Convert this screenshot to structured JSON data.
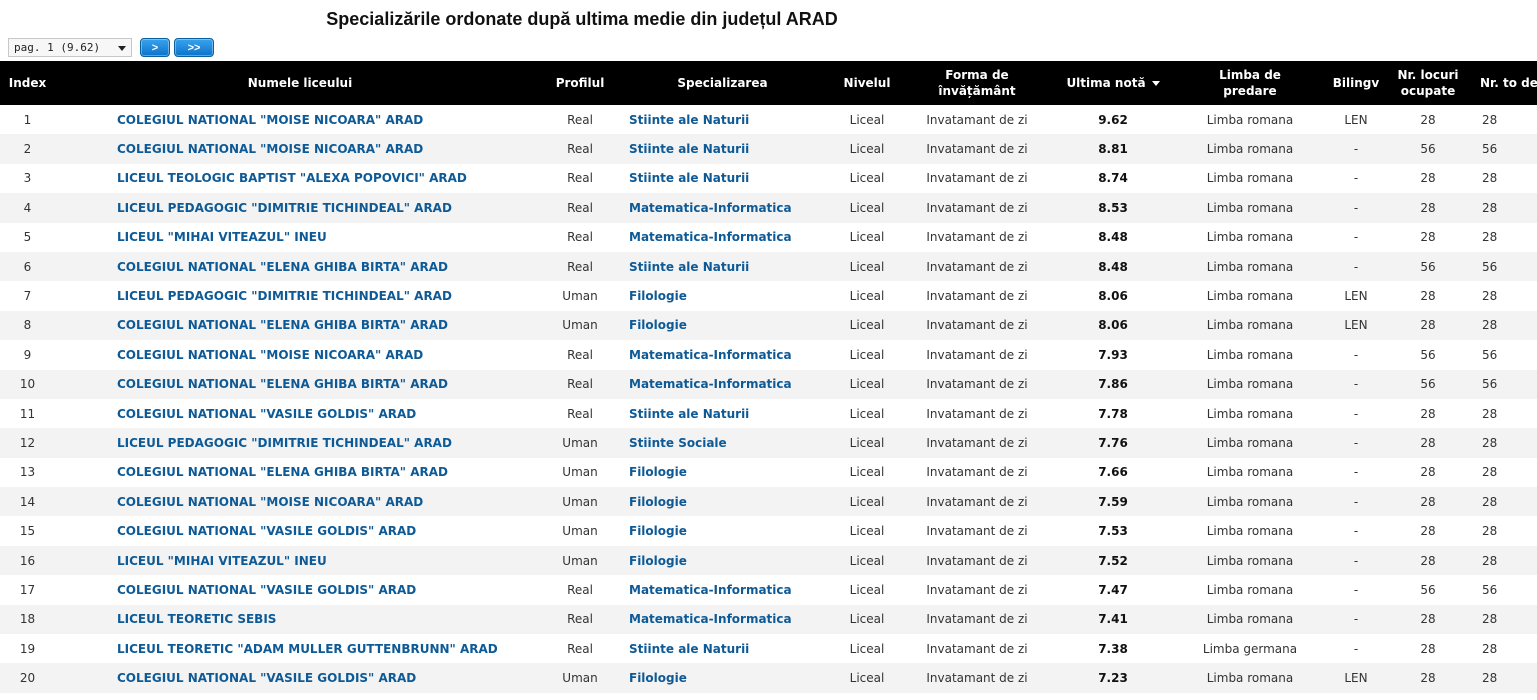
{
  "page": {
    "title": "Specializările ordonate după ultima medie din județul ARAD"
  },
  "pager": {
    "selected": "pag. 1 (9.62)",
    "next_label": ">",
    "last_label": ">>"
  },
  "table": {
    "headers": {
      "index": "Index",
      "school": "Numele liceului",
      "profile": "Profilul",
      "specialization": "Specializarea",
      "level": "Nivelul",
      "form": "Forma de învățământ",
      "last_grade": "Ultima notă",
      "language": "Limba de predare",
      "bilingual": "Bilingv",
      "occupied": "Nr. locuri ocupate",
      "total": "Nr. to de loc"
    },
    "rows": [
      {
        "index": "1",
        "school": "COLEGIUL NATIONAL \"MOISE NICOARA\" ARAD",
        "profile": "Real",
        "spec": "Stiinte ale Naturii",
        "level": "Liceal",
        "form": "Invatamant de zi",
        "grade": "9.62",
        "lang": "Limba romana",
        "bilingv": "LEN",
        "occupied": "28",
        "total": "28"
      },
      {
        "index": "2",
        "school": "COLEGIUL NATIONAL \"MOISE NICOARA\" ARAD",
        "profile": "Real",
        "spec": "Stiinte ale Naturii",
        "level": "Liceal",
        "form": "Invatamant de zi",
        "grade": "8.81",
        "lang": "Limba romana",
        "bilingv": "-",
        "occupied": "56",
        "total": "56"
      },
      {
        "index": "3",
        "school": "LICEUL TEOLOGIC BAPTIST \"ALEXA POPOVICI\" ARAD",
        "profile": "Real",
        "spec": "Stiinte ale Naturii",
        "level": "Liceal",
        "form": "Invatamant de zi",
        "grade": "8.74",
        "lang": "Limba romana",
        "bilingv": "-",
        "occupied": "28",
        "total": "28"
      },
      {
        "index": "4",
        "school": "LICEUL PEDAGOGIC \"DIMITRIE TICHINDEAL\" ARAD",
        "profile": "Real",
        "spec": "Matematica-Informatica",
        "level": "Liceal",
        "form": "Invatamant de zi",
        "grade": "8.53",
        "lang": "Limba romana",
        "bilingv": "-",
        "occupied": "28",
        "total": "28"
      },
      {
        "index": "5",
        "school": "LICEUL \"MIHAI VITEAZUL\" INEU",
        "profile": "Real",
        "spec": "Matematica-Informatica",
        "level": "Liceal",
        "form": "Invatamant de zi",
        "grade": "8.48",
        "lang": "Limba romana",
        "bilingv": "-",
        "occupied": "28",
        "total": "28"
      },
      {
        "index": "6",
        "school": "COLEGIUL NATIONAL \"ELENA GHIBA BIRTA\" ARAD",
        "profile": "Real",
        "spec": "Stiinte ale Naturii",
        "level": "Liceal",
        "form": "Invatamant de zi",
        "grade": "8.48",
        "lang": "Limba romana",
        "bilingv": "-",
        "occupied": "56",
        "total": "56"
      },
      {
        "index": "7",
        "school": "LICEUL PEDAGOGIC \"DIMITRIE TICHINDEAL\" ARAD",
        "profile": "Uman",
        "spec": "Filologie",
        "level": "Liceal",
        "form": "Invatamant de zi",
        "grade": "8.06",
        "lang": "Limba romana",
        "bilingv": "LEN",
        "occupied": "28",
        "total": "28"
      },
      {
        "index": "8",
        "school": "COLEGIUL NATIONAL \"ELENA GHIBA BIRTA\" ARAD",
        "profile": "Uman",
        "spec": "Filologie",
        "level": "Liceal",
        "form": "Invatamant de zi",
        "grade": "8.06",
        "lang": "Limba romana",
        "bilingv": "LEN",
        "occupied": "28",
        "total": "28"
      },
      {
        "index": "9",
        "school": "COLEGIUL NATIONAL \"MOISE NICOARA\" ARAD",
        "profile": "Real",
        "spec": "Matematica-Informatica",
        "level": "Liceal",
        "form": "Invatamant de zi",
        "grade": "7.93",
        "lang": "Limba romana",
        "bilingv": "-",
        "occupied": "56",
        "total": "56"
      },
      {
        "index": "10",
        "school": "COLEGIUL NATIONAL \"ELENA GHIBA BIRTA\" ARAD",
        "profile": "Real",
        "spec": "Matematica-Informatica",
        "level": "Liceal",
        "form": "Invatamant de zi",
        "grade": "7.86",
        "lang": "Limba romana",
        "bilingv": "-",
        "occupied": "56",
        "total": "56"
      },
      {
        "index": "11",
        "school": "COLEGIUL NATIONAL \"VASILE GOLDIS\" ARAD",
        "profile": "Real",
        "spec": "Stiinte ale Naturii",
        "level": "Liceal",
        "form": "Invatamant de zi",
        "grade": "7.78",
        "lang": "Limba romana",
        "bilingv": "-",
        "occupied": "28",
        "total": "28"
      },
      {
        "index": "12",
        "school": "LICEUL PEDAGOGIC \"DIMITRIE TICHINDEAL\" ARAD",
        "profile": "Uman",
        "spec": "Stiinte Sociale",
        "level": "Liceal",
        "form": "Invatamant de zi",
        "grade": "7.76",
        "lang": "Limba romana",
        "bilingv": "-",
        "occupied": "28",
        "total": "28"
      },
      {
        "index": "13",
        "school": "COLEGIUL NATIONAL \"ELENA GHIBA BIRTA\" ARAD",
        "profile": "Uman",
        "spec": "Filologie",
        "level": "Liceal",
        "form": "Invatamant de zi",
        "grade": "7.66",
        "lang": "Limba romana",
        "bilingv": "-",
        "occupied": "28",
        "total": "28"
      },
      {
        "index": "14",
        "school": "COLEGIUL NATIONAL \"MOISE NICOARA\" ARAD",
        "profile": "Uman",
        "spec": "Filologie",
        "level": "Liceal",
        "form": "Invatamant de zi",
        "grade": "7.59",
        "lang": "Limba romana",
        "bilingv": "-",
        "occupied": "28",
        "total": "28"
      },
      {
        "index": "15",
        "school": "COLEGIUL NATIONAL \"VASILE GOLDIS\" ARAD",
        "profile": "Uman",
        "spec": "Filologie",
        "level": "Liceal",
        "form": "Invatamant de zi",
        "grade": "7.53",
        "lang": "Limba romana",
        "bilingv": "-",
        "occupied": "28",
        "total": "28"
      },
      {
        "index": "16",
        "school": "LICEUL \"MIHAI VITEAZUL\" INEU",
        "profile": "Uman",
        "spec": "Filologie",
        "level": "Liceal",
        "form": "Invatamant de zi",
        "grade": "7.52",
        "lang": "Limba romana",
        "bilingv": "-",
        "occupied": "28",
        "total": "28"
      },
      {
        "index": "17",
        "school": "COLEGIUL NATIONAL \"VASILE GOLDIS\" ARAD",
        "profile": "Real",
        "spec": "Matematica-Informatica",
        "level": "Liceal",
        "form": "Invatamant de zi",
        "grade": "7.47",
        "lang": "Limba romana",
        "bilingv": "-",
        "occupied": "56",
        "total": "56"
      },
      {
        "index": "18",
        "school": "LICEUL TEORETIC SEBIS",
        "profile": "Real",
        "spec": "Matematica-Informatica",
        "level": "Liceal",
        "form": "Invatamant de zi",
        "grade": "7.41",
        "lang": "Limba romana",
        "bilingv": "-",
        "occupied": "28",
        "total": "28"
      },
      {
        "index": "19",
        "school": "LICEUL TEORETIC \"ADAM MULLER GUTTENBRUNN\" ARAD",
        "profile": "Real",
        "spec": "Stiinte ale Naturii",
        "level": "Liceal",
        "form": "Invatamant de zi",
        "grade": "7.38",
        "lang": "Limba germana",
        "bilingv": "-",
        "occupied": "28",
        "total": "28"
      },
      {
        "index": "20",
        "school": "COLEGIUL NATIONAL \"VASILE GOLDIS\" ARAD",
        "profile": "Uman",
        "spec": "Filologie",
        "level": "Liceal",
        "form": "Invatamant de zi",
        "grade": "7.23",
        "lang": "Limba romana",
        "bilingv": "LEN",
        "occupied": "28",
        "total": "28"
      }
    ]
  }
}
